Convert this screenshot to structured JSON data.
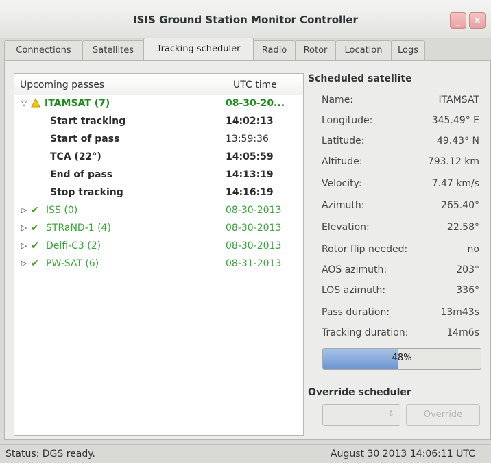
{
  "window": {
    "title": "ISIS Ground Station Monitor Controller",
    "minimize_label": "_",
    "close_label": "×"
  },
  "tabs": [
    {
      "label": "Connections"
    },
    {
      "label": "Satellites"
    },
    {
      "label": "Tracking scheduler",
      "active": true
    },
    {
      "label": "Radio"
    },
    {
      "label": "Rotor"
    },
    {
      "label": "Location"
    },
    {
      "label": "Logs"
    }
  ],
  "passes": {
    "columns": [
      "Upcoming passes",
      "UTC time"
    ],
    "groups": [
      {
        "name": "ITAMSAT (7)",
        "date": "08-30-20...",
        "status": "warning",
        "expanded": true,
        "children": [
          {
            "label": "Start tracking",
            "time": "14:02:13"
          },
          {
            "label": "Start of pass",
            "time": "13:59:36"
          },
          {
            "label": "TCA (22°)",
            "time": "14:05:59"
          },
          {
            "label": "End of pass",
            "time": "14:13:19"
          },
          {
            "label": "Stop tracking",
            "time": "14:16:19"
          }
        ]
      },
      {
        "name": "ISS (0)",
        "date": "08-30-2013",
        "status": "ok"
      },
      {
        "name": "STRaND-1 (4)",
        "date": "08-30-2013",
        "status": "ok"
      },
      {
        "name": "Delfi-C3 (2)",
        "date": "08-30-2013",
        "status": "ok"
      },
      {
        "name": "PW-SAT (6)",
        "date": "08-31-2013",
        "status": "ok"
      }
    ]
  },
  "scheduled": {
    "heading": "Scheduled satellite",
    "fields": [
      {
        "key": "Name:",
        "value": "ITAMSAT"
      },
      {
        "key": "Longitude:",
        "value": "345.49° E"
      },
      {
        "key": "Latitude:",
        "value": "49.43° N"
      },
      {
        "key": "Altitude:",
        "value": "793.12 km"
      },
      {
        "key": "Velocity:",
        "value": "7.47 km/s"
      },
      {
        "key": "Azimuth:",
        "value": "265.40°"
      },
      {
        "key": "Elevation:",
        "value": "22.58°"
      },
      {
        "key": "Rotor flip needed:",
        "value": "no"
      },
      {
        "key": "AOS azimuth:",
        "value": "203°"
      },
      {
        "key": "LOS azimuth:",
        "value": "336°"
      },
      {
        "key": "Pass duration:",
        "value": "13m43s"
      },
      {
        "key": "Tracking duration:",
        "value": "14m6s"
      }
    ],
    "progress_label": "48%",
    "progress_value": 0.48
  },
  "override": {
    "heading": "Override scheduler",
    "button_label": "Override",
    "combo_value": ""
  },
  "status": {
    "text": "Status: DGS ready.",
    "datetime": "August 30 2013 14:06:11 UTC"
  },
  "colors": {
    "ok_green": "#3aa33a",
    "warning_yellow": "#e8b800",
    "progress_blue": "#6a95d0"
  }
}
